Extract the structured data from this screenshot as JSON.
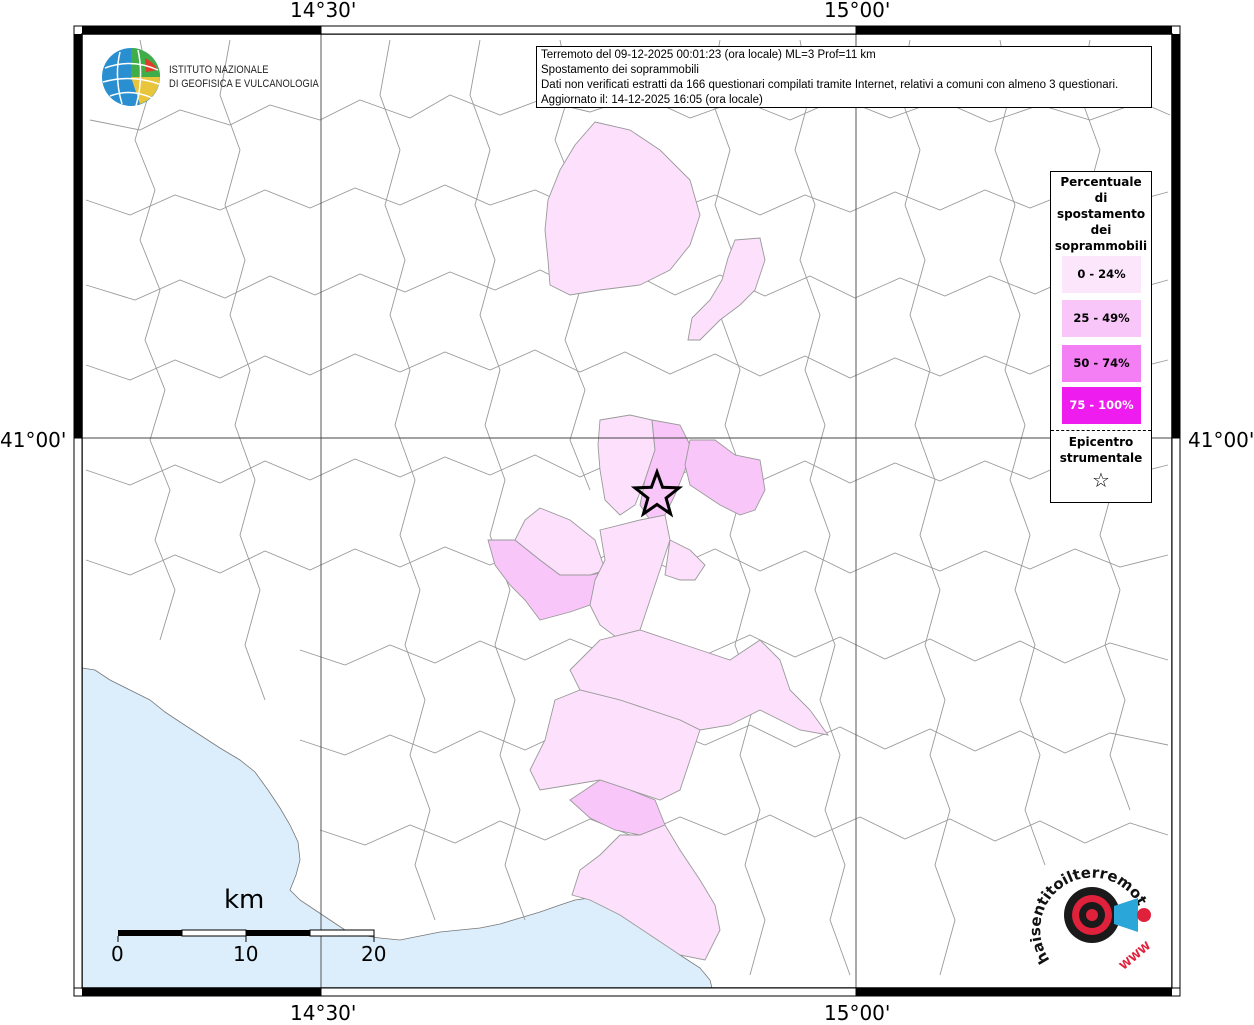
{
  "coords": {
    "lon_left": "14°30'",
    "lon_right": "15°00'",
    "lat": "41°00'"
  },
  "info_box": {
    "line1": "Terremoto del 09-12-2025 00:01:23 (ora locale) ML=3 Prof=11 km",
    "line2": "Spostamento dei soprammobili",
    "line3": "Dati non verificati estratti da 166 questionari compilati tramite Internet, relativi a comuni con almeno 3 questionari.",
    "line4": "Aggiornato il: 14-12-2025 16:05 (ora locale)"
  },
  "legend": {
    "title": "Percentuale di spostamento dei soprammobili",
    "items": [
      {
        "label": "0 - 24%",
        "color": "#fce6fc"
      },
      {
        "label": "25 - 49%",
        "color": "#f9c6f9"
      },
      {
        "label": "50 - 74%",
        "color": "#f47ef4"
      },
      {
        "label": "75 - 100%",
        "color": "#ee1cee"
      }
    ],
    "epicenter_label": "Epicentro strumentale",
    "epicenter_symbol": "☆"
  },
  "logo_ingv": {
    "line1": "ISTITUTO NAZIONALE",
    "line2": "DI GEOFISICA E VULCANOLOGIA"
  },
  "logo_hst": {
    "text": "haisentitoilterremoto.it",
    "sub": "WWW"
  },
  "scale_bar": {
    "unit": "km",
    "ticks": [
      "0",
      "10",
      "20"
    ]
  },
  "colors": {
    "sea": "#dceefb",
    "border": "#888888",
    "grid": "#555555",
    "frame": "#000000"
  }
}
